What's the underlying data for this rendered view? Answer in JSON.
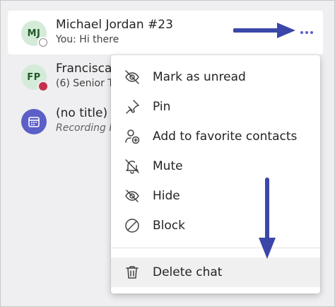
{
  "chats": [
    {
      "initials": "MJ",
      "name": "Michael Jordan #23",
      "preview": "You: Hi there",
      "presence": "offline"
    },
    {
      "initials": "FP",
      "name": "Francisca",
      "preview": "(6) Senior T",
      "presence": "busy"
    },
    {
      "initials": "",
      "name": "(no title)",
      "preview": "Recording F",
      "icon": "calendar-icon"
    }
  ],
  "more_options_icon": "more-options-icon",
  "menu": {
    "items": [
      {
        "label": "Mark as unread",
        "icon": "eye-off-icon"
      },
      {
        "label": "Pin",
        "icon": "pin-icon"
      },
      {
        "label": "Add to favorite contacts",
        "icon": "person-add-icon"
      },
      {
        "label": "Mute",
        "icon": "bell-off-icon"
      },
      {
        "label": "Hide",
        "icon": "eye-slash-icon"
      },
      {
        "label": "Block",
        "icon": "block-icon"
      }
    ],
    "delete": {
      "label": "Delete chat",
      "icon": "trash-icon"
    }
  },
  "colors": {
    "accent": "#5b5fc7",
    "arrow": "#3b47a8",
    "busy": "#c4314b",
    "avatar_bg": "#d5ebd9"
  }
}
